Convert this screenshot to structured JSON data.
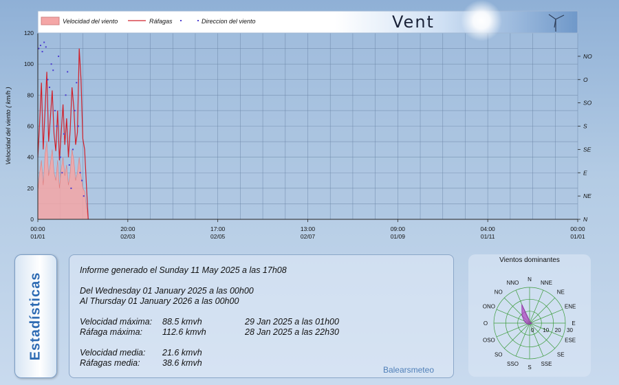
{
  "chart_data": [
    {
      "type": "line",
      "legend": {
        "labels": [
          "Velocidad del viento",
          "Ráfagas",
          "Direccion del viento"
        ],
        "colors": [
          "#f4a6a6",
          "#d0202a",
          "#4a3ad0"
        ]
      },
      "banner_title": "Vent",
      "ylabel": "Velocidad del viento  ( km/h )",
      "ylim": [
        0,
        120
      ],
      "yticks": [
        "0",
        "20",
        "40",
        "60",
        "80",
        "100",
        "120"
      ],
      "right_ticks": [
        "N",
        "NE",
        "E",
        "SE",
        "S",
        "SO",
        "O",
        "NO"
      ],
      "x_ticks": [
        {
          "pos": 0,
          "time": "00:00",
          "date": "01/01"
        },
        {
          "pos": 1,
          "time": "20:00",
          "date": "02/03"
        },
        {
          "pos": 2,
          "time": "17:00",
          "date": "02/05"
        },
        {
          "pos": 3,
          "time": "13:00",
          "date": "02/07"
        },
        {
          "pos": 4,
          "time": "09:00",
          "date": "01/09"
        },
        {
          "pos": 5,
          "time": "04:00",
          "date": "01/11"
        },
        {
          "pos": 6,
          "time": "00:00",
          "date": "01/01"
        }
      ],
      "series": [
        {
          "name": "Velocidad del viento",
          "color": "#f4a6a6",
          "x": [
            0,
            0.02,
            0.04,
            0.06,
            0.08,
            0.1,
            0.12,
            0.14,
            0.16,
            0.18,
            0.2,
            0.22,
            0.24,
            0.26,
            0.28,
            0.3,
            0.32,
            0.34,
            0.36,
            0.38,
            0.4,
            0.42,
            0.44,
            0.46,
            0.48,
            0.5,
            0.52,
            0.54,
            0.56
          ],
          "values": [
            18,
            30,
            38,
            22,
            42,
            50,
            28,
            36,
            45,
            30,
            25,
            38,
            20,
            32,
            40,
            28,
            35,
            22,
            30,
            45,
            38,
            25,
            30,
            40,
            28,
            20,
            18,
            8,
            0
          ]
        },
        {
          "name": "Ráfagas",
          "color": "#d0202a",
          "x": [
            0,
            0.02,
            0.04,
            0.06,
            0.08,
            0.1,
            0.12,
            0.14,
            0.16,
            0.18,
            0.2,
            0.22,
            0.24,
            0.26,
            0.28,
            0.3,
            0.32,
            0.34,
            0.36,
            0.38,
            0.4,
            0.42,
            0.44,
            0.46,
            0.48,
            0.5,
            0.52,
            0.54,
            0.56
          ],
          "values": [
            40,
            62,
            88,
            45,
            70,
            95,
            50,
            66,
            83,
            55,
            44,
            70,
            38,
            56,
            74,
            48,
            65,
            40,
            58,
            85,
            72,
            48,
            56,
            110,
            90,
            52,
            45,
            22,
            0
          ]
        },
        {
          "name": "Direccion del viento",
          "color": "#4a3ad0",
          "x": [
            0.01,
            0.03,
            0.05,
            0.07,
            0.09,
            0.11,
            0.13,
            0.15,
            0.17,
            0.19,
            0.21,
            0.23,
            0.25,
            0.27,
            0.29,
            0.31,
            0.33,
            0.35,
            0.37,
            0.39,
            0.41,
            0.43,
            0.45,
            0.47,
            0.49,
            0.51
          ],
          "values": [
            110,
            112,
            108,
            114,
            111,
            90,
            85,
            100,
            96,
            70,
            60,
            105,
            40,
            30,
            55,
            80,
            95,
            35,
            20,
            45,
            70,
            88,
            60,
            30,
            25,
            15
          ]
        }
      ]
    },
    {
      "type": "radar",
      "title": "Vientos dominantes",
      "directions": [
        "N",
        "NNE",
        "NE",
        "ENE",
        "E",
        "ESE",
        "SE",
        "SSE",
        "S",
        "SSO",
        "SO",
        "OSO",
        "O",
        "ONO",
        "NO",
        "NNO"
      ],
      "rlim": [
        0,
        30
      ],
      "rticks": [
        "0",
        "10",
        "20",
        "30"
      ],
      "values": [
        2,
        1,
        1,
        1,
        2,
        1,
        1,
        1,
        1,
        1,
        1,
        2,
        3,
        5,
        9,
        17
      ],
      "fill": "#b04ac4"
    }
  ],
  "stats": {
    "tab_label": "Estadísticas",
    "generated": "Informe generado el Sunday 11 May 2025 a las 17h08",
    "from": "Del Wednesday 01 January 2025 a las 00h00",
    "to": "Al Thursday 01 January 2026 a las 00h00",
    "rows": [
      {
        "label": "Velocidad máxima:",
        "value": "88.5 kmvh",
        "when": "29 Jan 2025 a las 01h00"
      },
      {
        "label": "Ráfaga máxima:",
        "value": "112.6 kmvh",
        "when": "28 Jan 2025 a las 22h30"
      },
      {
        "label": "Velocidad media:",
        "value": "21.6 kmvh",
        "when": ""
      },
      {
        "label": "Ráfagas media:",
        "value": "38.6 kmvh",
        "when": ""
      }
    ],
    "credit": "Balearsmeteo"
  }
}
